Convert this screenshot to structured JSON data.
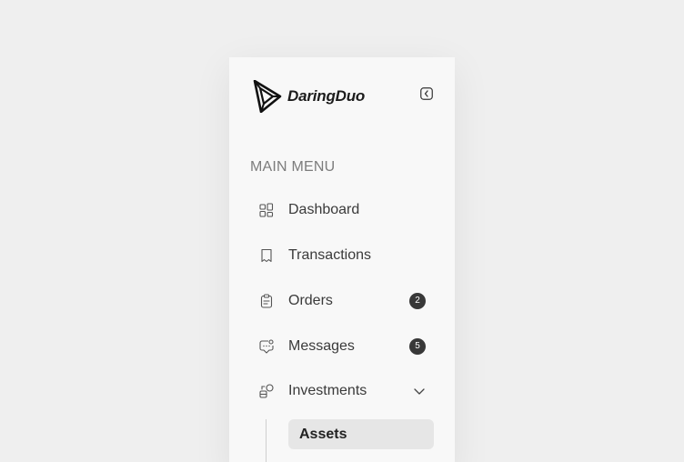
{
  "brand": {
    "name": "DaringDuo",
    "logo_icon": "triangle-logo-icon"
  },
  "sidebar": {
    "collapse_icon": "chevron-left-icon",
    "section_title": "MAIN MENU",
    "items": [
      {
        "label": "Dashboard",
        "icon": "grid-icon"
      },
      {
        "label": "Transactions",
        "icon": "receipt-icon"
      },
      {
        "label": "Orders",
        "icon": "clipboard-icon",
        "badge": "2"
      },
      {
        "label": "Messages",
        "icon": "chat-icon",
        "badge": "5"
      },
      {
        "label": "Investments",
        "icon": "investment-icon",
        "expanded": true,
        "children": [
          {
            "label": "Assets",
            "active": true
          }
        ]
      }
    ]
  },
  "colors": {
    "background": "#efefef",
    "panel": "#f8f8f8",
    "badge": "#383838",
    "active_item": "#e6e6e6",
    "muted_text": "#7c7c7c",
    "text": "#3a3a3a"
  }
}
